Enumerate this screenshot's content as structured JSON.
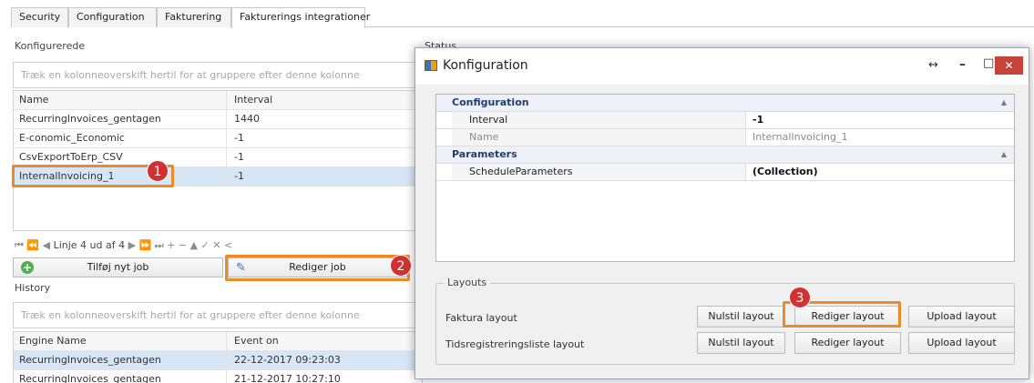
{
  "tabs": [
    "Security",
    "Configuration",
    "Fakturering",
    "Fakturerings integrationer"
  ],
  "configured": {
    "label": "Konfigurerede",
    "group_hint": "Træk en kolonneoverskift hertil for at gruppere efter denne kolonne",
    "columns": [
      "Name",
      "Interval"
    ],
    "rows": [
      {
        "name": "RecurringInvoices_gentagen",
        "interval": "1440"
      },
      {
        "name": "E-conomic_Economic",
        "interval": "-1"
      },
      {
        "name": "CsvExportToErp_CSV",
        "interval": "-1"
      },
      {
        "name": "InternalInvoicing_1",
        "interval": "-1"
      }
    ],
    "nav_text": "Linje 4 ud af 4",
    "nav_left": "⏮ ⏪ ◀",
    "nav_right": "▶ ⏩ ⏭ + − ▲ ✓ ✕ <"
  },
  "buttons": {
    "add_job": "Tilføj nyt job",
    "edit_job": "Rediger job"
  },
  "status_label": "Status",
  "history": {
    "label": "History",
    "group_hint": "Træk en kolonneoverskift hertil for at gruppere efter denne kolonne",
    "columns": [
      "Engine Name",
      "Event on"
    ],
    "rows": [
      {
        "engine": "RecurringInvoices_gentagen",
        "event": "22-12-2017 09:23:03"
      },
      {
        "engine": "RecurringInvoices_gentagen",
        "event": "21-12-2017 10:27:10"
      }
    ]
  },
  "badges": [
    "1",
    "2",
    "3"
  ],
  "dialog": {
    "title": "Konfiguration",
    "controls": {
      "resize": "↔",
      "minimize": "–",
      "maximize": "□",
      "close": "✕"
    },
    "categories": [
      {
        "name": "Configuration",
        "props": [
          {
            "name": "Interval",
            "value": "-1",
            "bold": true
          },
          {
            "name": "Name",
            "value": "InternalInvoicing_1",
            "bold": false
          }
        ]
      },
      {
        "name": "Parameters",
        "props": [
          {
            "name": "ScheduleParameters",
            "value": "(Collection)",
            "bold": true
          }
        ]
      }
    ],
    "layouts": {
      "legend": "Layouts",
      "rows": [
        {
          "label": "Faktura layout",
          "reset": "Nulstil layout",
          "edit": "Rediger layout",
          "upload": "Upload layout"
        },
        {
          "label": "Tidsregistreringsliste layout",
          "reset": "Nulstil layout",
          "edit": "Rediger layout",
          "upload": "Upload layout"
        }
      ]
    }
  },
  "colors": {
    "accent": "#ee8a26",
    "badge": "#d33131",
    "close": "#c9423a",
    "selected_row": "#d6e6f5",
    "category_text": "#1f3c73"
  }
}
